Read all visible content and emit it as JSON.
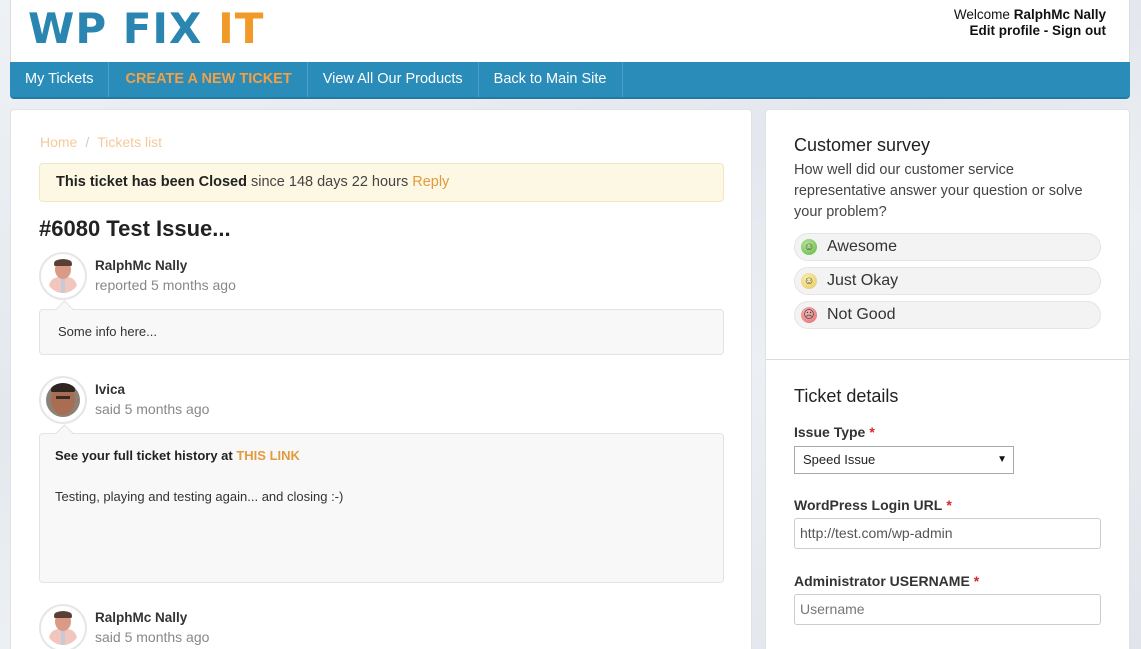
{
  "header": {
    "logo_main": "WP FIX",
    "logo_accent": "IT",
    "welcome_label": "Welcome",
    "username": "RalphMc Nally",
    "edit_profile": "Edit profile",
    "separator": "-",
    "sign_out": "Sign out"
  },
  "nav": {
    "items": [
      {
        "label": "My Tickets"
      },
      {
        "label": "CREATE A NEW TICKET"
      },
      {
        "label": "View All Our Products"
      },
      {
        "label": "Back to Main Site"
      }
    ]
  },
  "breadcrumb": {
    "home": "Home",
    "separator": "/",
    "current": "Tickets list"
  },
  "alert": {
    "status": "This ticket has been Closed",
    "since": "since 148 days 22 hours",
    "reply": "Reply"
  },
  "ticket": {
    "title": "#6080 Test Issue..."
  },
  "posts": [
    {
      "author": "RalphMc Nally",
      "meta": "reported 5 months ago",
      "body": "Some info here..."
    },
    {
      "author": "Ivica",
      "meta": "said 5 months ago",
      "history_text": "See your full ticket history at",
      "history_link": "THIS LINK",
      "body": "Testing, playing and testing again... and closing :-)"
    },
    {
      "author": "RalphMc Nally",
      "meta": "said 5 months ago"
    }
  ],
  "survey": {
    "title": "Customer survey",
    "question": "How well did our customer service representative answer your question or solve your problem?",
    "options": [
      {
        "label": "Awesome",
        "icon": "smiley-happy-icon",
        "color": "#5fb63b"
      },
      {
        "label": "Just Okay",
        "icon": "smiley-neutral-icon",
        "color": "#e6c659"
      },
      {
        "label": "Not Good",
        "icon": "smiley-sad-icon",
        "color": "#e06b6b"
      }
    ]
  },
  "details": {
    "title": "Ticket details",
    "required_mark": "*",
    "issue_type_label": "Issue Type",
    "issue_type_value": "Speed Issue",
    "login_url_label": "WordPress Login URL",
    "login_url_value": "http://test.com/wp-admin",
    "admin_user_label": "Administrator USERNAME",
    "admin_user_placeholder": "Username"
  },
  "colors": {
    "brand_blue": "#2a8cb8",
    "brand_orange": "#f19a2a",
    "alert_bg": "#fcf8e3"
  }
}
